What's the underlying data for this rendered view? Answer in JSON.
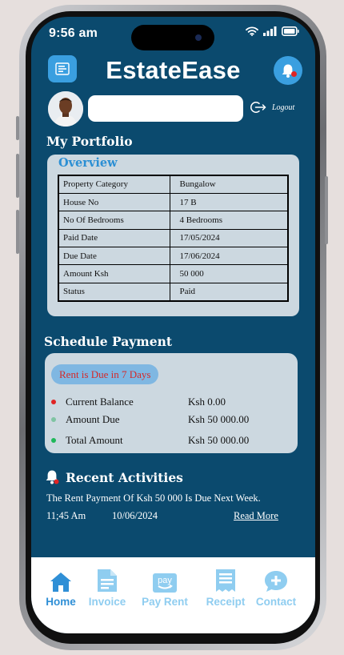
{
  "status_bar": {
    "time": "9:56 am"
  },
  "app": {
    "title": "EstateEase"
  },
  "profile": {
    "logout_label": "Logout"
  },
  "portfolio": {
    "title": "My Portfolio",
    "overview_title": "Overview",
    "rows": [
      {
        "label": "Property Category",
        "value": "Bungalow"
      },
      {
        "label": "House No",
        "value": "17 B"
      },
      {
        "label": "No Of Bedrooms",
        "value": "4 Bedrooms"
      },
      {
        "label": "Paid Date",
        "value": "17/05/2024"
      },
      {
        "label": "Due Date",
        "value": "17/06/2024"
      },
      {
        "label": "Amount Ksh",
        "value": "50 000"
      },
      {
        "label": "Status",
        "value": "Paid"
      }
    ]
  },
  "schedule": {
    "title": "Schedule Payment",
    "due_badge": "Rent is Due in 7 Days",
    "rows": [
      {
        "label": "Current Balance",
        "amount": "Ksh 0.00",
        "dot_color": "#e02424"
      },
      {
        "label": "Amount Due",
        "amount": "Ksh 50 000.00",
        "dot_color": "#7fc4a2"
      },
      {
        "label": "Total Amount",
        "amount": "Ksh 50 000.00",
        "dot_color": "#1fb85a"
      }
    ]
  },
  "activities": {
    "title": "Recent Activities",
    "text": "The Rent Payment Of Ksh 50 000 Is Due Next Week.",
    "time": "11;45 Am",
    "date": "10/06/2024",
    "read_more": "Read More"
  },
  "nav": {
    "items": [
      {
        "label": "Home",
        "icon": "home-icon",
        "active": true
      },
      {
        "label": "Invoice",
        "icon": "invoice-icon",
        "active": false
      },
      {
        "label": "Pay Rent",
        "icon": "pay-icon",
        "active": false
      },
      {
        "label": "Receipt",
        "icon": "receipt-icon",
        "active": false
      },
      {
        "label": "Contact",
        "icon": "contact-icon",
        "active": false
      }
    ]
  },
  "colors": {
    "background": "#0b4a6e",
    "accent": "#3a9fe0",
    "card": "#ccd8e0",
    "nav_active": "#2f8fd6",
    "nav_inactive": "#8fcdf0",
    "alert": "#d42a2a"
  }
}
